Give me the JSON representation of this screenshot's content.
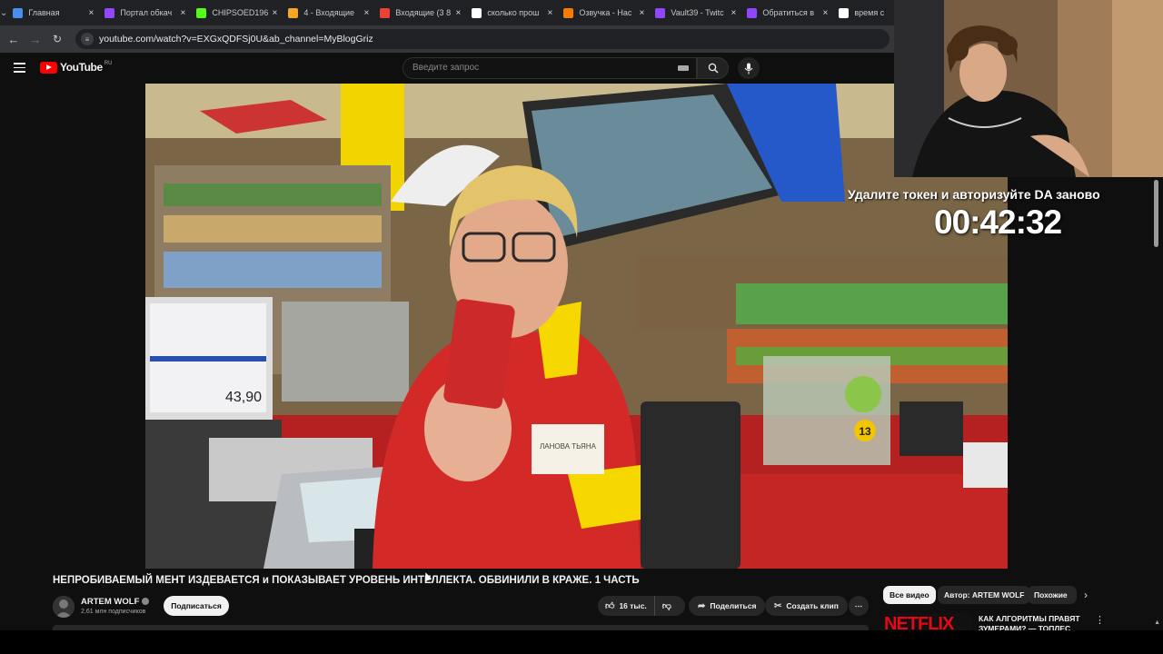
{
  "browser": {
    "tabs": [
      {
        "title": "Главная",
        "favicon_color": "#4a8ef0",
        "icon": "home-app-icon"
      },
      {
        "title": "Портал обкач",
        "favicon_color": "#9146ff",
        "icon": "twitch-icon"
      },
      {
        "title": "CHIPSOED196",
        "favicon_color": "#53fc18",
        "icon": "kick-icon"
      },
      {
        "title": "4 - Входящие",
        "favicon_color": "#f5a623",
        "icon": "mail-icon"
      },
      {
        "title": "Входящие (3 8",
        "favicon_color": "#ea4335",
        "icon": "gmail-icon"
      },
      {
        "title": "сколько прош",
        "favicon_color": "#ffffff",
        "icon": "google-icon"
      },
      {
        "title": "Озвучка - Нас",
        "favicon_color": "#f57c00",
        "icon": "donationalerts-icon"
      },
      {
        "title": "Vault39 - Twitc",
        "favicon_color": "#9146ff",
        "icon": "twitch-icon"
      },
      {
        "title": "Обратиться в",
        "favicon_color": "#9146ff",
        "icon": "twitch-icon"
      },
      {
        "title": "время с",
        "favicon_color": "#ffffff",
        "icon": "google-icon"
      }
    ],
    "url": "youtube.com/watch?v=EXGxQDFSj0U&ab_channel=MyBlogGriz"
  },
  "youtube": {
    "logo_text": "YouTube",
    "region": "RU",
    "search_placeholder": "Введите запрос"
  },
  "stream_overlay": {
    "message": "Удалите токен и авторизуйте DA заново",
    "timer": "00:42:32"
  },
  "video": {
    "title": "НЕПРОБИВАЕМЫЙ МЕНТ ИЗДЕВАЕТСЯ и ПОКАЗЫВАЕТ УРОВЕНЬ ИНТЕЛЛЕКТА. ОБВИНИЛИ В КРАЖЕ. 1 ЧАСТЬ",
    "channel_name": "ARTEM WOLF",
    "subscribers": "2,61 млн подписчиков",
    "subscribe_label": "Подписаться",
    "likes": "16 тыс.",
    "share_label": "Поделиться",
    "clip_label": "Создать клип",
    "price_tag": "43,90",
    "badge_number": "13",
    "name_tag": "ЛАНОВА ТЬЯНА"
  },
  "sidebar": {
    "chips": [
      "Все видео",
      "Автор: ARTEM WOLF",
      "Похожие"
    ],
    "recommendation": {
      "thumb_text": "NETFLIX",
      "title": "КАК АЛГОРИТМЫ ПРАВЯТ ЗУМЕРАМИ? — ТОПЛЕС"
    }
  },
  "colors": {
    "youtube_red": "#ff0000",
    "background": "#0f0f0f",
    "chip_bg": "#272727"
  }
}
